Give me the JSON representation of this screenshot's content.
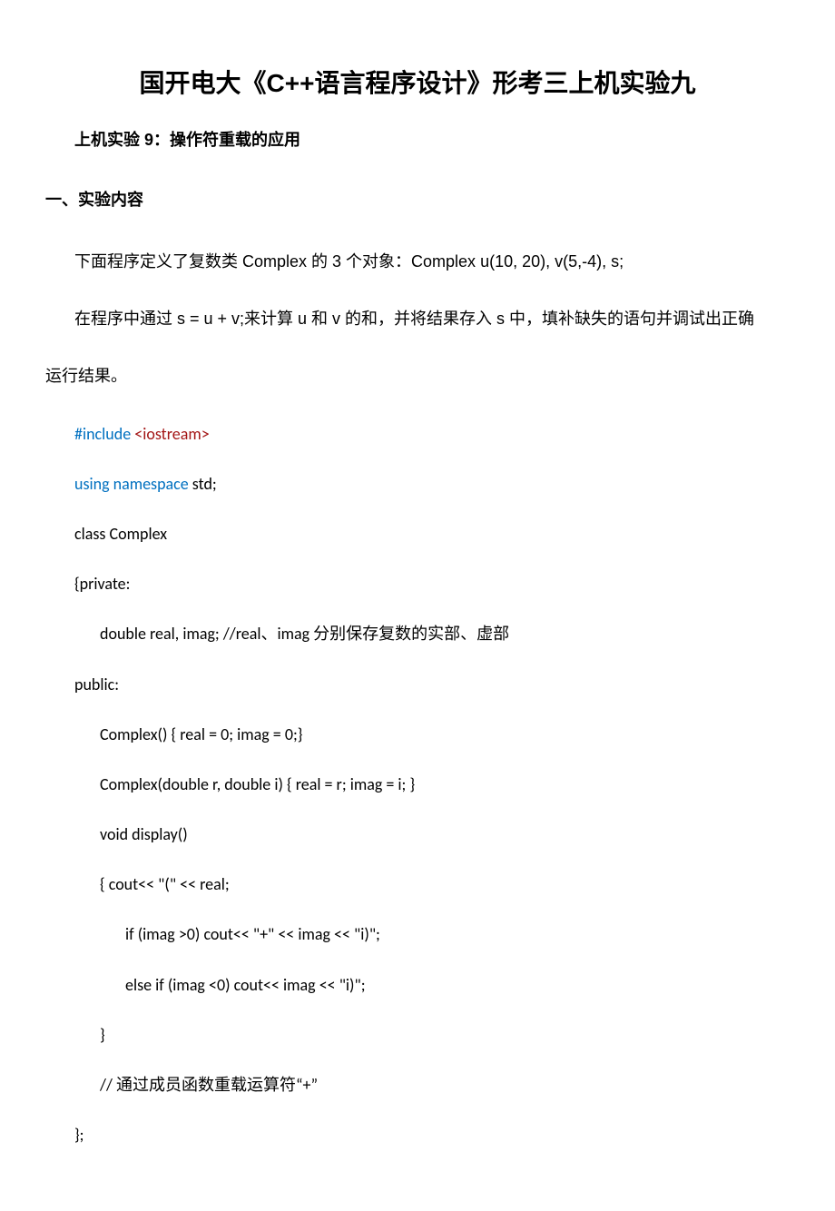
{
  "title": "国开电大《C++语言程序设计》形考三上机实验九",
  "subtitle": "上机实验 9：操作符重载的应用",
  "section1": "一、实验内容",
  "para1": "下面程序定义了复数类 Complex 的 3 个对象：Complex u(10, 20), v(5,-4), s;",
  "para2_a": "在程序中通过 s = u + v;来计算 u 和 v 的和，并将结果存入 s 中，填补缺失的语句并调试出正确",
  "para2_b": "运行结果。",
  "code": {
    "l1_a": "#include",
    "l1_b": "<iostream>",
    "l2_a": "using namespace",
    "l2_b": " std;",
    "l3": "class Complex",
    "l4": "{private:",
    "l5": "double real, imag; //real、imag 分别保存复数的实部、虚部",
    "l6": "public:",
    "l7": "Complex() { real = 0; imag = 0;}",
    "l8": "Complex(double r, double i) { real = r; imag = i; }",
    "l9": "void display()",
    "l10": "{ cout<< \"(\" << real;",
    "l11": "if (imag >0) cout<< \"+\" << imag << \"i)\";",
    "l12": "else if (imag <0) cout<< imag << \"i)\";",
    "l13": "}",
    "l14": "//  通过成员函数重载运算符“+”",
    "l15": "};"
  }
}
